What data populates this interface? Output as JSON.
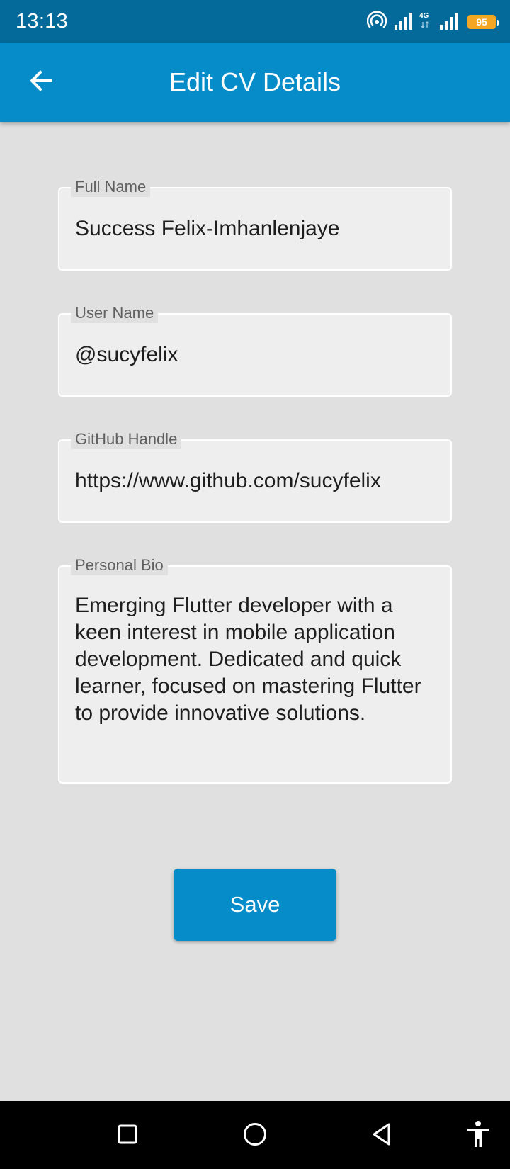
{
  "status_bar": {
    "time": "13:13",
    "network": "4G",
    "battery": "95",
    "battery_color": "#f5a623"
  },
  "app_bar": {
    "title": "Edit CV Details",
    "back_icon": "arrow-left-icon",
    "color": "#068cc9"
  },
  "form": {
    "full_name": {
      "label": "Full Name",
      "value": "Success Felix-Imhanlenjaye"
    },
    "user_name": {
      "label": "User Name",
      "value": "@sucyfelix"
    },
    "github": {
      "label": "GitHub Handle",
      "value": "https://www.github.com/sucyfelix"
    },
    "bio": {
      "label": "Personal Bio",
      "value": "Emerging Flutter developer with a keen interest in mobile application development. Dedicated and quick learner, focused on mastering Flutter to provide innovative solutions."
    }
  },
  "actions": {
    "save_label": "Save"
  },
  "nav_bar": {
    "icons": [
      "recents-square-icon",
      "home-circle-icon",
      "back-triangle-icon",
      "accessibility-icon"
    ]
  }
}
